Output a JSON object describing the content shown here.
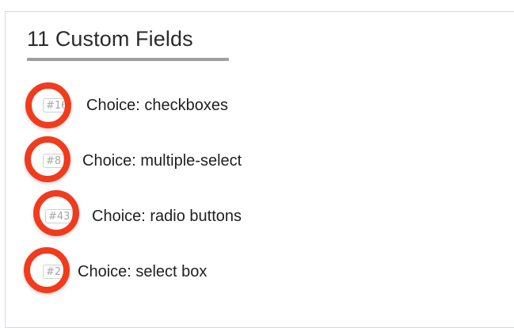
{
  "title": "11 Custom Fields",
  "fields": [
    {
      "id": "#16",
      "label": "Choice: checkboxes"
    },
    {
      "id": "#8",
      "label": "Choice: multiple-select"
    },
    {
      "id": "#43",
      "label": "Choice: radio buttons"
    },
    {
      "id": "#2",
      "label": "Choice: select box"
    }
  ],
  "colors": {
    "highlight": "#f23a1d",
    "underline": "#9f9f9f",
    "badge_text": "#a7a7a7",
    "label_text": "#1f1f1f",
    "title_text": "#2b2b2b"
  }
}
